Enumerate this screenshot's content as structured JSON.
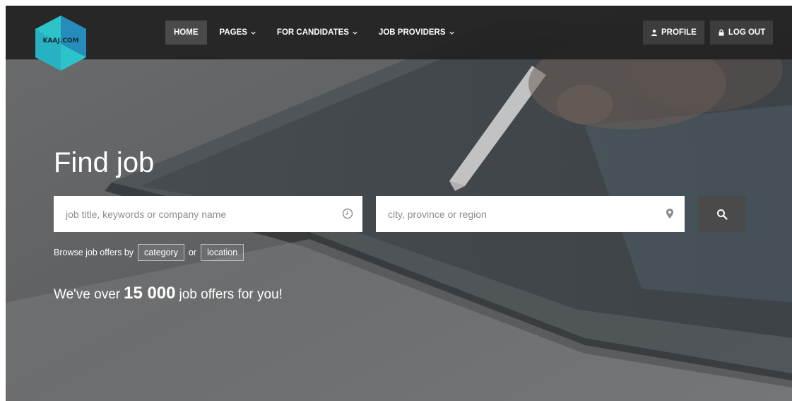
{
  "logo": {
    "text": "KAAJ.COM"
  },
  "nav": {
    "items": [
      {
        "label": "HOME",
        "active": true,
        "dropdown": false
      },
      {
        "label": "PAGES",
        "active": false,
        "dropdown": true
      },
      {
        "label": "FOR CANDIDATES",
        "active": false,
        "dropdown": true
      },
      {
        "label": "JOB PROVIDERS",
        "active": false,
        "dropdown": true
      }
    ],
    "profile_label": "PROFILE",
    "logout_label": "LOG OUT"
  },
  "hero": {
    "title": "Find job",
    "search": {
      "keywords_placeholder": "job title, keywords or company name",
      "location_placeholder": "city, province or region"
    },
    "browse": {
      "prefix": "Browse job offers by",
      "category_label": "category",
      "or_label": "or",
      "location_label": "location"
    },
    "offers": {
      "prefix": "We've over",
      "count": "15 000",
      "suffix": "job offers for you!"
    }
  },
  "icons": {
    "keywords_field": "clock-icon",
    "location_field": "map-marker-icon",
    "search_button": "search-icon",
    "profile": "user-icon",
    "logout": "lock-icon",
    "dropdown": "chevron-down-icon"
  },
  "colors": {
    "navbar": "#222222",
    "nav_active": "#4a4a4a",
    "logo_teal": "#2cc3c9",
    "logo_blue": "#2583b8",
    "search_button": "#4a4a4a"
  }
}
